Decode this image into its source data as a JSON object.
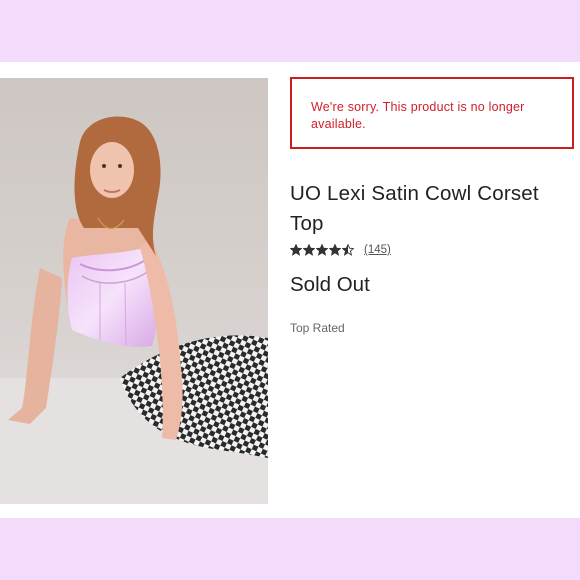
{
  "notice": {
    "text": "We're sorry. This product is no longer available."
  },
  "product": {
    "title": "UO Lexi Satin Cowl Corset Top",
    "rating": 4.5,
    "review_count": "(145)",
    "status": "Sold Out",
    "badge": "Top Rated"
  },
  "colors": {
    "frame_bg": "#f3dcfb",
    "notice_red": "#cc1e1e",
    "corset_lilac": "#e3b8ee"
  },
  "image": {
    "subject": "model-wearing-lilac-satin-corset-top",
    "icon": "product-photo"
  }
}
